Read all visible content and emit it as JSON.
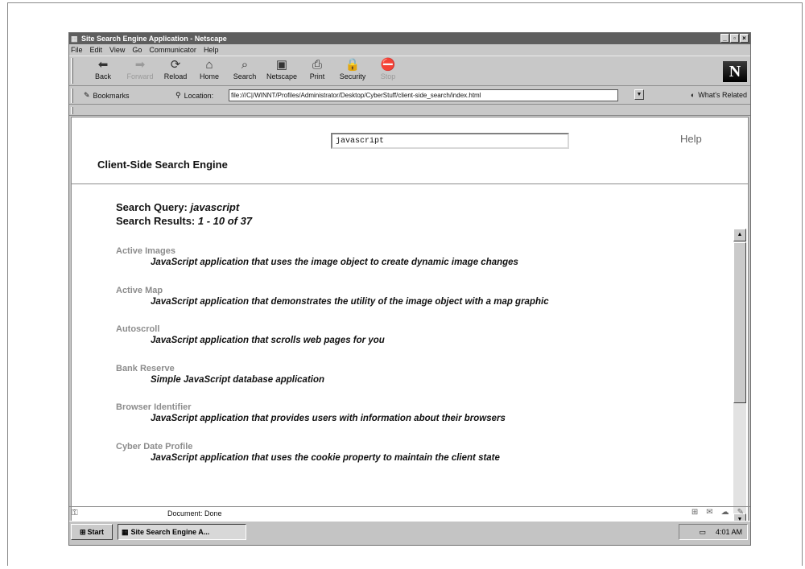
{
  "window": {
    "title": "Site Search Engine Application - Netscape",
    "controls": [
      "_",
      "▫",
      "×"
    ]
  },
  "menu": [
    "File",
    "Edit",
    "View",
    "Go",
    "Communicator",
    "Help"
  ],
  "toolbar": {
    "buttons": [
      {
        "label": "Back",
        "icon": "back-arrow-icon",
        "glyph": "⬅"
      },
      {
        "label": "Forward",
        "icon": "forward-arrow-icon",
        "glyph": "➡"
      },
      {
        "label": "Reload",
        "icon": "reload-icon",
        "glyph": "⟳"
      },
      {
        "label": "Home",
        "icon": "home-icon",
        "glyph": "⌂"
      },
      {
        "label": "Search",
        "icon": "search-icon",
        "glyph": "⌕"
      },
      {
        "label": "Netscape",
        "icon": "netscape-icon",
        "glyph": "▣"
      },
      {
        "label": "Print",
        "icon": "print-icon",
        "glyph": "⎙"
      },
      {
        "label": "Security",
        "icon": "security-lock-icon",
        "glyph": "🔒"
      },
      {
        "label": "Stop",
        "icon": "stop-icon",
        "glyph": "⛔"
      }
    ],
    "logo": "N"
  },
  "location": {
    "bookmarks_label": "Bookmarks",
    "location_label": "Location:",
    "url": "file:///C|/WINNT/Profiles/Administrator/Desktop/CyberStuff/client-side_search/index.html",
    "whats_related": "What's Related"
  },
  "page": {
    "app_title": "Client-Side Search Engine",
    "query_value": "javascript",
    "help_label": "Help",
    "query_label": "Search Query:",
    "query_text": "javascript",
    "results_label": "Search Results:",
    "results_range": "1 - 10 of 37",
    "results": [
      {
        "title": "Active Images",
        "description": "JavaScript application that uses the image object to create dynamic image changes"
      },
      {
        "title": "Active Map",
        "description": "JavaScript application that demonstrates the utility of the image object with a map graphic"
      },
      {
        "title": "Autoscroll",
        "description": "JavaScript application that scrolls web pages for you"
      },
      {
        "title": "Bank Reserve",
        "description": "Simple JavaScript database application"
      },
      {
        "title": "Browser Identifier",
        "description": "JavaScript application that provides users with information about their browsers"
      },
      {
        "title": "Cyber Date Profile",
        "description": "JavaScript application that uses the cookie property to maintain the client state"
      }
    ]
  },
  "status": {
    "text": "Document: Done"
  },
  "taskbar": {
    "start_label": "Start",
    "task_label": "Site Search Engine A...",
    "clock": "4:01 AM"
  }
}
